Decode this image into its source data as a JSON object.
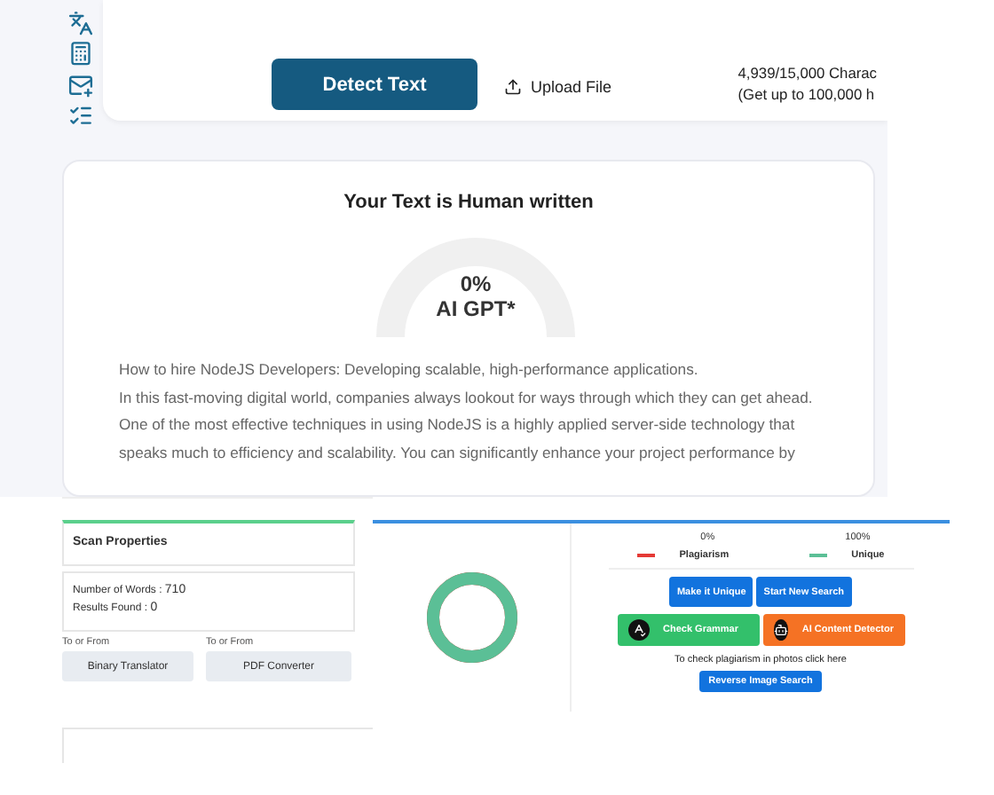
{
  "toolbar": {
    "detect_button": "Detect Text",
    "upload": "Upload File",
    "counter": [
      "4,939/15,000 Charac",
      "(Get up to 100,000 h"
    ]
  },
  "result": {
    "title": "Your Text is Human written",
    "gauge": {
      "percent": "0%",
      "label": "AI GPT*"
    },
    "paragraph": [
      "How to hire NodeJS Developers: Developing scalable, high-performance applications.",
      "In this fast-moving digital world, companies always lookout for ways through which they can get ahead.",
      "One of the most effective techniques in using NodeJS is a highly applied server-side technology that",
      "speaks much to efficiency and scalability. You can significantly enhance your project performance by"
    ]
  },
  "scan_properties": {
    "title": "Scan Properties",
    "stats": [
      {
        "label": "Number of Words : ",
        "value": "710"
      },
      {
        "label": "Results Found : ",
        "value": "0"
      }
    ],
    "links": [
      {
        "caption": "To or From",
        "button": "Binary Translator"
      },
      {
        "caption": "To or From",
        "button": "PDF Converter"
      }
    ]
  },
  "report": {
    "donut": {
      "level": 1
    },
    "legend": [
      {
        "percent": "0%",
        "label": "Plagiarism",
        "color": "#e53935"
      },
      {
        "percent": "100%",
        "label": "Unique",
        "color": "#5bbf96"
      }
    ],
    "buttons": [
      {
        "label": "Make it Unique",
        "kind": "blue"
      },
      {
        "label": "Start New Search",
        "kind": "blue"
      },
      {
        "label": "Check Grammar",
        "kind": "green"
      },
      {
        "label": "AI Content Detector",
        "kind": "orange"
      }
    ],
    "photo_text": "To check plagiarism in photos click here",
    "reverse_button": "Reverse Image Search"
  }
}
